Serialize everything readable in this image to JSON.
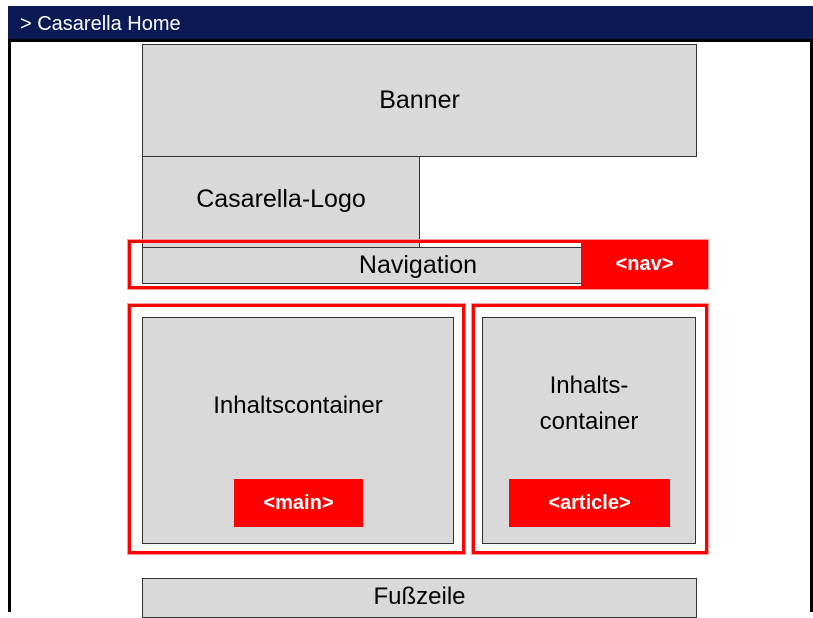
{
  "window": {
    "title": "> Casarella Home"
  },
  "regions": {
    "banner": "Banner",
    "logo": "Casarella-Logo",
    "navigation": "Navigation",
    "main_content": "Inhaltscontainer",
    "article_content_line1": "Inhalts-",
    "article_content_line2": "container",
    "footer": "Fußzeile"
  },
  "tags": {
    "nav": "<nav>",
    "main": "<main>",
    "article": "<article>"
  },
  "colors": {
    "titlebar": "#0b1a55",
    "box_fill": "#d9d9d9",
    "semantic_tag": "#ff0000"
  }
}
